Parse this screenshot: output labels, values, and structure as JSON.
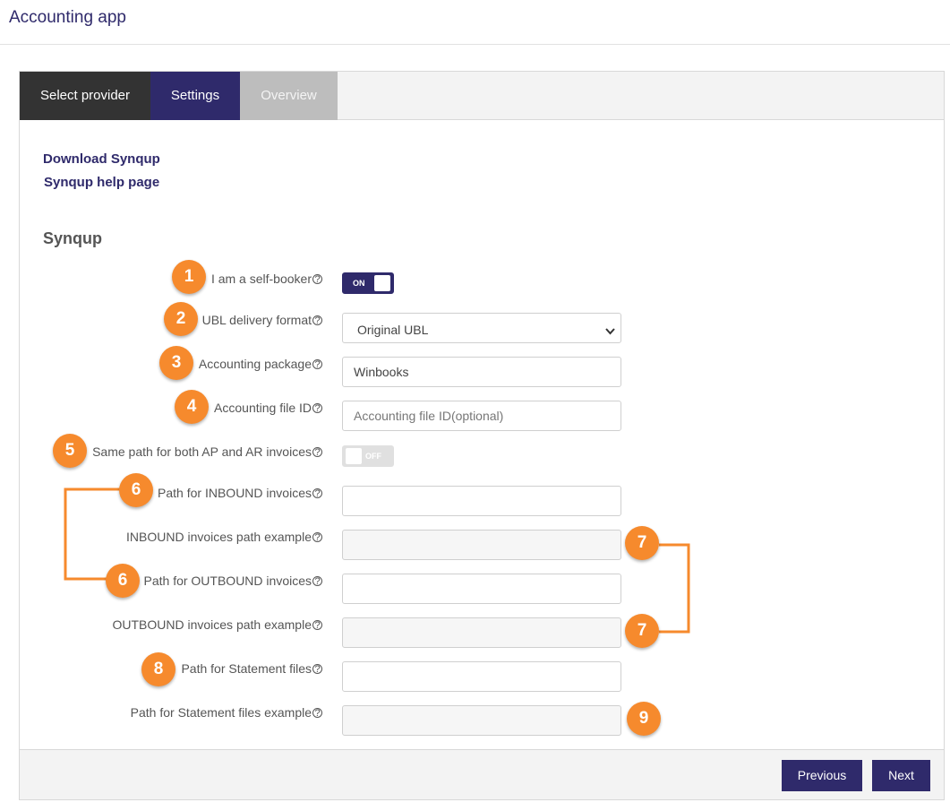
{
  "app": {
    "title": "Accounting app"
  },
  "tabs": [
    {
      "label": "Select provider"
    },
    {
      "label": "Settings"
    },
    {
      "label": "Overview"
    }
  ],
  "links": {
    "download": "Download Synqup",
    "help": "Synqup help page"
  },
  "section_title": "Synqup",
  "help_icon": "question-circle-icon",
  "fields": {
    "self_booker": {
      "label": "I am a self-booker",
      "toggle": "ON"
    },
    "ubl_format": {
      "label": "UBL delivery format",
      "value": "Original UBL"
    },
    "accounting_package": {
      "label": "Accounting package",
      "value": "Winbooks"
    },
    "accounting_file_id": {
      "label": "Accounting file ID",
      "placeholder": "Accounting file ID(optional)"
    },
    "same_path": {
      "label": "Same path for both AP and AR invoices",
      "toggle": "OFF"
    },
    "inbound_path": {
      "label": "Path for INBOUND invoices",
      "value": ""
    },
    "inbound_example": {
      "label": "INBOUND invoices path example",
      "value": ""
    },
    "outbound_path": {
      "label": "Path for OUTBOUND invoices",
      "value": ""
    },
    "outbound_example": {
      "label": "OUTBOUND invoices path example",
      "value": ""
    },
    "statement_path": {
      "label": "Path for Statement files",
      "value": ""
    },
    "statement_example": {
      "label": "Path for Statement files example",
      "value": ""
    }
  },
  "badges": [
    "1",
    "2",
    "3",
    "4",
    "5",
    "6",
    "6",
    "7",
    "7",
    "8",
    "9"
  ],
  "footer": {
    "previous": "Previous",
    "next": "Next"
  },
  "colors": {
    "brand": "#2f2a6b",
    "annotation": "#f68a2d",
    "tab_active_dark": "#333333",
    "tab_inactive": "#bdbdbd"
  }
}
